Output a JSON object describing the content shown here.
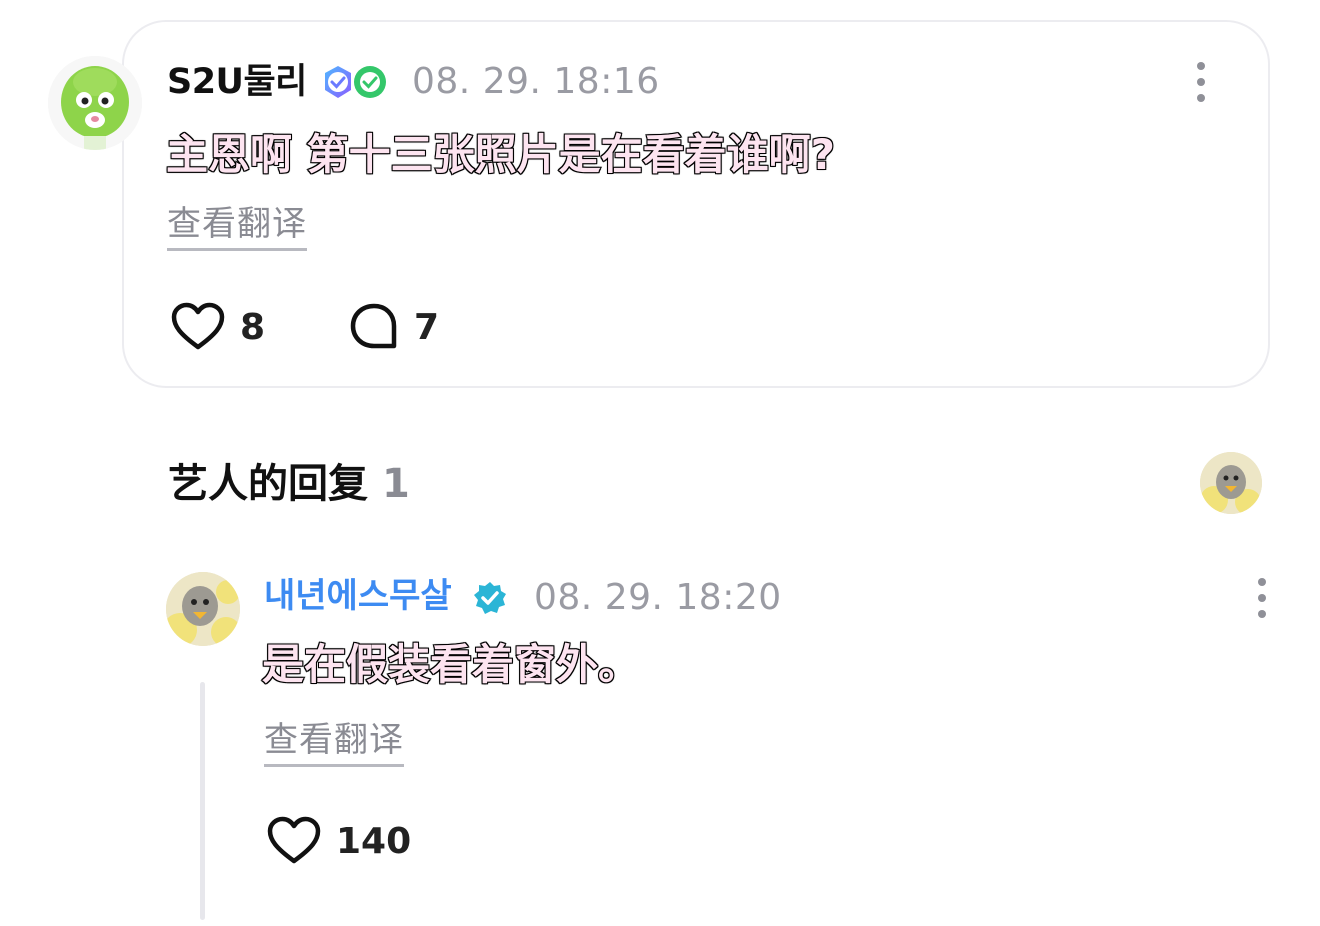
{
  "comment": {
    "username": "S2U둘리",
    "timestamp": "08. 29. 18:16",
    "subtitle": "主恩啊 第十三张照片是在看着谁啊?",
    "translate_label": "查看翻译",
    "likes": "8",
    "replies": "7",
    "badges": [
      "shield-check-badge-icon",
      "green-check-badge-icon"
    ]
  },
  "section": {
    "title": "艺人的回复",
    "count": "1"
  },
  "reply": {
    "username": "내년에스무살",
    "timestamp": "08. 29. 18:20",
    "subtitle": "是在假装看着窗外。",
    "translate_label": "查看翻译",
    "likes": "140",
    "verified_icon": "verified-badge-icon"
  },
  "colors": {
    "accent_blue": "#3d8bf2",
    "muted_gray": "#9a9ba3",
    "subtitle_fill": "#fde4f0",
    "verified_teal": "#2bb5d6"
  }
}
